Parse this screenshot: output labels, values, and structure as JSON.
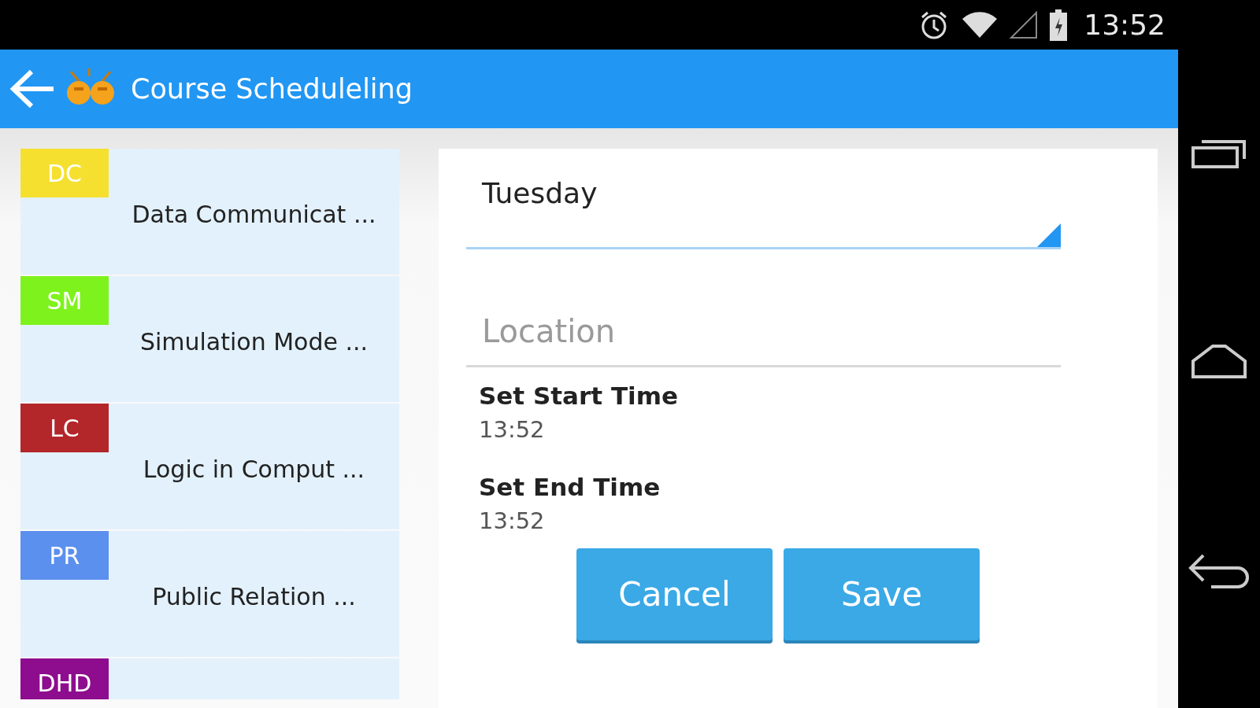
{
  "status_bar": {
    "time": "13:52"
  },
  "app_bar": {
    "title": "Course Scheduleling"
  },
  "courses": [
    {
      "code": "DC",
      "name": "Data Communicat ...",
      "color": "#f5e030"
    },
    {
      "code": "SM",
      "name": "Simulation Mode ...",
      "color": "#7ef21c"
    },
    {
      "code": "LC",
      "name": "Logic in Comput ...",
      "color": "#b3262a"
    },
    {
      "code": "PR",
      "name": "Public Relation ...",
      "color": "#5c90ee"
    },
    {
      "code": "DHD",
      "color": "#8e0c8e"
    }
  ],
  "form": {
    "day": "Tuesday",
    "location": {
      "placeholder": "Location"
    },
    "start_label": "Set Start Time",
    "start_time": "13:52",
    "end_label": "Set End Time",
    "end_time": "13:52",
    "buttons": [
      "Cancel",
      "Save"
    ]
  }
}
